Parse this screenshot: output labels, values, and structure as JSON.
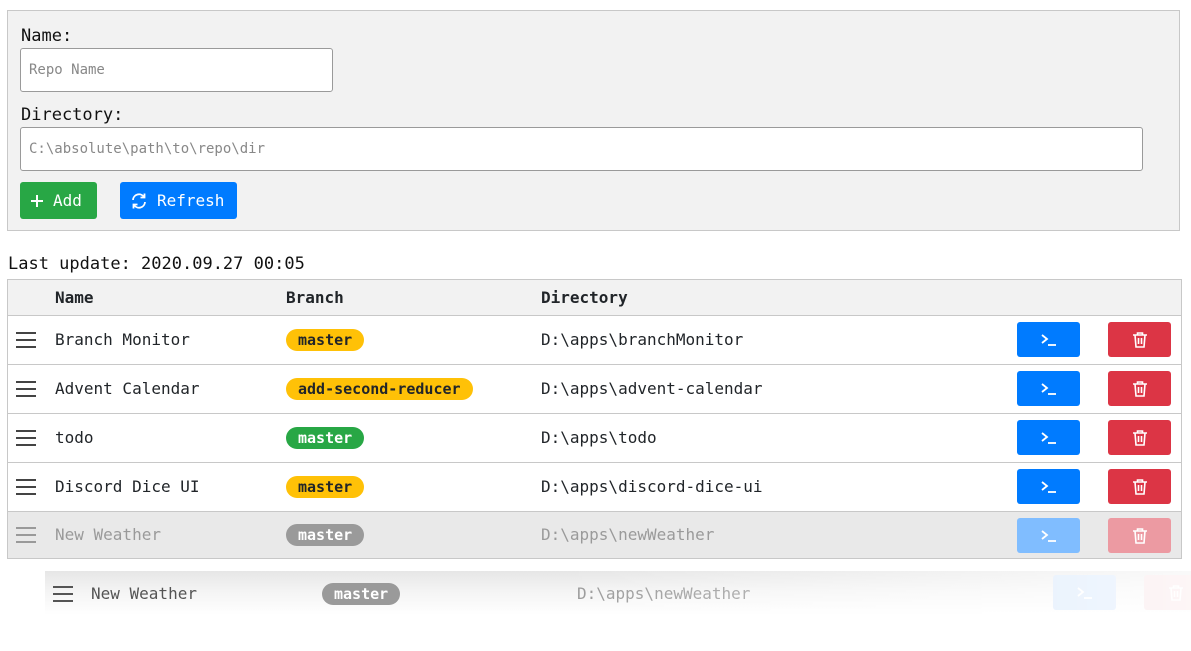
{
  "form": {
    "name_label": "Name:",
    "name_placeholder": "Repo Name",
    "name_value": "",
    "directory_label": "Directory:",
    "directory_placeholder": "C:\\absolute\\path\\to\\repo\\dir",
    "directory_value": "",
    "add_label": "Add",
    "refresh_label": "Refresh"
  },
  "last_update": "Last update: 2020.09.27 00:05",
  "table": {
    "headers": {
      "name": "Name",
      "branch": "Branch",
      "directory": "Directory"
    },
    "rows": [
      {
        "name": "Branch Monitor",
        "branch": "master",
        "branch_color": "#ffc107",
        "directory": "D:\\apps\\branchMonitor"
      },
      {
        "name": "Advent Calendar",
        "branch": "add-second-reducer",
        "branch_color": "#ffc107",
        "directory": "D:\\apps\\advent-calendar"
      },
      {
        "name": "todo",
        "branch": "master",
        "branch_color": "#28a745",
        "directory": "D:\\apps\\todo"
      },
      {
        "name": "Discord Dice UI",
        "branch": "master",
        "branch_color": "#ffc107",
        "directory": "D:\\apps\\discord-dice-ui"
      },
      {
        "name": "New Weather",
        "branch": "master",
        "branch_color": "#8a8a8a",
        "directory": "D:\\apps\\newWeather",
        "state": "dragging-placeholder"
      }
    ]
  },
  "drag_preview": {
    "name": "New Weather",
    "branch": "master",
    "directory": "D:\\apps\\newWeather"
  },
  "icons": {
    "drag": "drag-handle-icon",
    "add": "plus-icon",
    "refresh": "refresh-icon",
    "open": "terminal-icon",
    "delete": "trash-icon"
  },
  "colors": {
    "primary": "#007bff",
    "success": "#28a745",
    "warning": "#ffc107",
    "danger": "#dc3545"
  }
}
